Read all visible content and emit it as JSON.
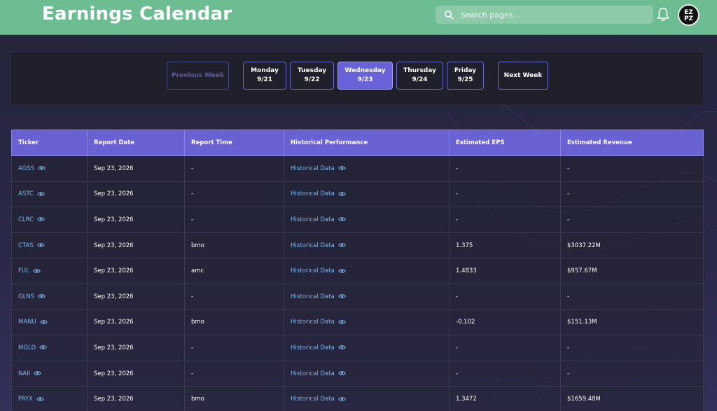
{
  "header": {
    "title": "Earnings Calendar",
    "search_placeholder": "Search pages...",
    "avatar_text_top": "EZ",
    "avatar_text_bottom": "PZ"
  },
  "week_nav": {
    "previous_label": "Previous Week",
    "next_label": "Next Week",
    "days": [
      {
        "day": "Monday",
        "date": "9/21",
        "active": false
      },
      {
        "day": "Tuesday",
        "date": "9/22",
        "active": false
      },
      {
        "day": "Wednesday",
        "date": "9/23",
        "active": true
      },
      {
        "day": "Thursday",
        "date": "9/24",
        "active": false
      },
      {
        "day": "Friday",
        "date": "9/25",
        "active": false
      }
    ]
  },
  "table": {
    "columns": [
      "Ticker",
      "Report Date",
      "Report Time",
      "Historical Performance",
      "Estimated EPS",
      "Estimated Revenue"
    ],
    "rows": [
      {
        "ticker": "AGSS",
        "date": "Sep 23, 2026",
        "time": "-",
        "hist": "Historical Data",
        "eps": "-",
        "rev": "-"
      },
      {
        "ticker": "ASTC",
        "date": "Sep 23, 2026",
        "time": "-",
        "hist": "Historical Data",
        "eps": "-",
        "rev": "-"
      },
      {
        "ticker": "CLRC",
        "date": "Sep 23, 2026",
        "time": "-",
        "hist": "Historical Data",
        "eps": "-",
        "rev": "-"
      },
      {
        "ticker": "CTAS",
        "date": "Sep 23, 2026",
        "time": "bmo",
        "hist": "Historical Data",
        "eps": "1.375",
        "rev": "$3037.22M"
      },
      {
        "ticker": "FUL",
        "date": "Sep 23, 2026",
        "time": "amc",
        "hist": "Historical Data",
        "eps": "1.4833",
        "rev": "$957.67M"
      },
      {
        "ticker": "GLNS",
        "date": "Sep 23, 2026",
        "time": "-",
        "hist": "Historical Data",
        "eps": "-",
        "rev": "-"
      },
      {
        "ticker": "MANU",
        "date": "Sep 23, 2026",
        "time": "bmo",
        "hist": "Historical Data",
        "eps": "-0.102",
        "rev": "$151.13M"
      },
      {
        "ticker": "MGLD",
        "date": "Sep 23, 2026",
        "time": "-",
        "hist": "Historical Data",
        "eps": "-",
        "rev": "-"
      },
      {
        "ticker": "NAII",
        "date": "Sep 23, 2026",
        "time": "-",
        "hist": "Historical Data",
        "eps": "-",
        "rev": "-"
      },
      {
        "ticker": "PAYX",
        "date": "Sep 23, 2026",
        "time": "bmo",
        "hist": "Historical Data",
        "eps": "1.3472",
        "rev": "$1659.48M"
      }
    ]
  },
  "icons": {
    "search": "search-icon",
    "bell": "bell-icon",
    "eye": "eye-icon"
  },
  "colors": {
    "header_bg": "#6dbd92",
    "accent": "#6a62d2",
    "link": "#7fb8e8"
  }
}
